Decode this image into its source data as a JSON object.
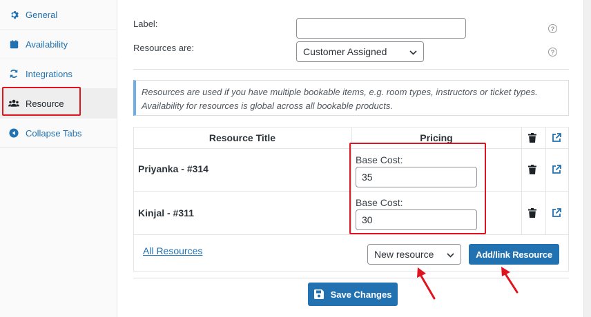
{
  "sidebar": {
    "tabs": [
      {
        "label": "General",
        "icon": "gear-icon"
      },
      {
        "label": "Availability",
        "icon": "calendar-icon"
      },
      {
        "label": "Integrations",
        "icon": "sync-icon"
      },
      {
        "label": "Resource",
        "icon": "users-icon"
      },
      {
        "label": "Collapse Tabs",
        "icon": "collapse-icon"
      }
    ],
    "active_tab": "Resource"
  },
  "form": {
    "label_label": "Label:",
    "label_value": "",
    "resources_are_label": "Resources are:",
    "resources_are_value": "Customer Assigned"
  },
  "notice": {
    "text": "Resources are used if you have multiple bookable items, e.g. room types, instructors or ticket types. Availability for resources is global across all bookable products."
  },
  "table": {
    "headers": [
      "Resource Title",
      "Pricing"
    ],
    "rows": [
      {
        "title": "Priyanka - #314",
        "base_cost_label": "Base Cost:",
        "base_cost": "35"
      },
      {
        "title": "Kinjal - #311",
        "base_cost_label": "Base Cost:",
        "base_cost": "30"
      }
    ]
  },
  "footer": {
    "all_resources_link": "All Resources",
    "new_resource_select": "New resource",
    "add_link_button": "Add/link Resource"
  },
  "save_button": "Save Changes",
  "colors": {
    "accent": "#2271b1",
    "highlight_red": "#e0141e"
  }
}
